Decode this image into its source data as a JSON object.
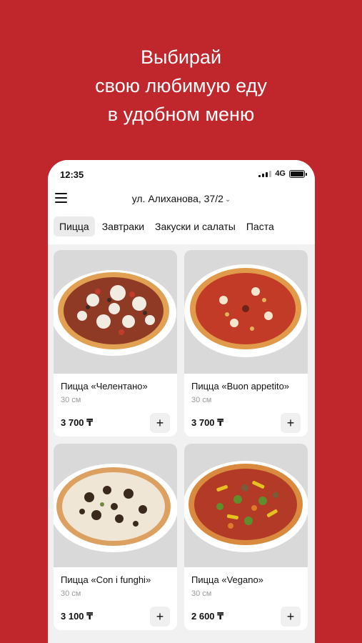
{
  "promo": {
    "line1": "Выбирай",
    "line2": "свою любимую еду",
    "line3": "в удобном меню"
  },
  "status_bar": {
    "time": "12:35",
    "network": "4G",
    "icons": [
      "signal-icon",
      "battery-icon"
    ]
  },
  "header": {
    "menu_icon": "menu-icon",
    "address": "ул. Алиханова, 37/2",
    "address_icon": "chevron-down-icon"
  },
  "tabs": [
    {
      "label": "Пицца",
      "active": true
    },
    {
      "label": "Завтраки",
      "active": false
    },
    {
      "label": "Закуски и салаты",
      "active": false
    },
    {
      "label": "Паста",
      "active": false
    }
  ],
  "products": [
    {
      "name": "Пицца «Челентано»",
      "size": "30 см",
      "price": "3 700 ₸",
      "add_label": "+"
    },
    {
      "name": "Пицца «Buon appetito»",
      "size": "30 см",
      "price": "3 700 ₸",
      "add_label": "+"
    },
    {
      "name": "Пицца «Con i funghi»",
      "size": "30 см",
      "price": "3 100 ₸",
      "add_label": "+"
    },
    {
      "name": "Пицца «Vegano»",
      "size": "30 см",
      "price": "2 600 ₸",
      "add_label": "+"
    }
  ],
  "colors": {
    "brand_background": "#c0272d",
    "card_background": "#ffffff",
    "screen_background": "#f1f1f1"
  }
}
